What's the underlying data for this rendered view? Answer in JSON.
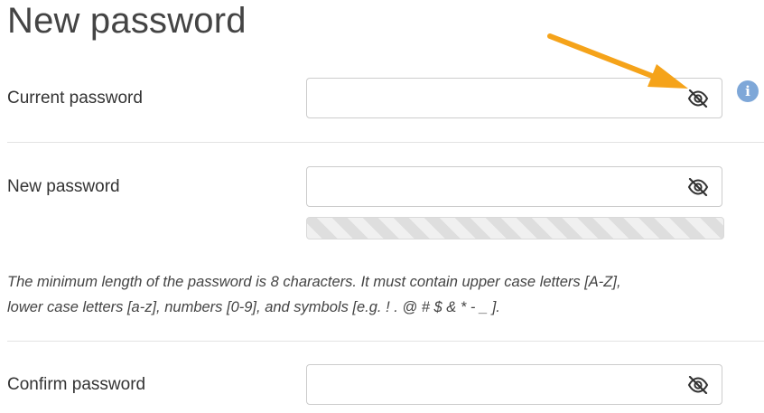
{
  "page": {
    "title": "New password"
  },
  "fields": {
    "current": {
      "label": "Current password",
      "value": "",
      "placeholder": ""
    },
    "new": {
      "label": "New password",
      "value": "",
      "placeholder": ""
    },
    "confirm": {
      "label": "Confirm password",
      "value": "",
      "placeholder": ""
    }
  },
  "hint": {
    "line1": "The minimum length of the password is 8 characters. It must contain upper case letters [A-Z],",
    "line2": "lower case letters [a-z], numbers [0-9], and symbols [e.g. ! . @ # $ & * - _ ]."
  },
  "info": {
    "glyph": "i"
  },
  "icons": {
    "toggle_visibility": "eye-slash-icon",
    "info": "info-icon",
    "annotation": "arrow-annotation"
  },
  "colors": {
    "info_badge": "#7ea7d8",
    "annotation_arrow": "#f5a31a",
    "strength_bar": "#dedede"
  }
}
